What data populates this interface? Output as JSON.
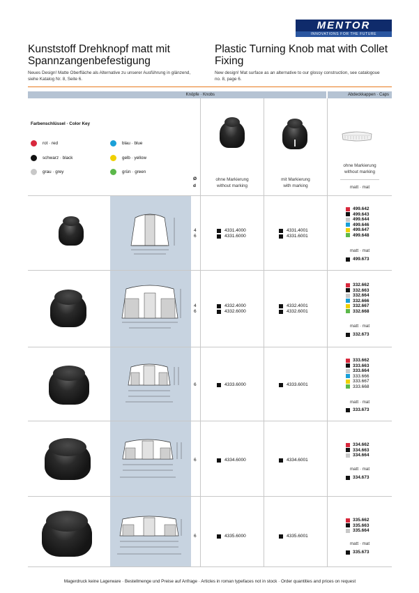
{
  "logo": {
    "word": "MENTOR",
    "tagline": "INNOVATIONS FOR THE FUTURE"
  },
  "title_de": "Kunststoff Drehknopf matt mit Spannzangenbefestigung",
  "title_en": "Plastic Turning Knob mat with Collet Fixing",
  "subtitle_de": "Neues Design! Matte Oberfläche als Alternative zu unserer Ausführung in glänzend, siehe Katalog Nr. 8, Seite 6.",
  "subtitle_en": "New design! Mat surface as an alternative to our glossy construction, see catalogoue no. 8, page 6.",
  "header": {
    "knobs": "Knöpfe · Knobs",
    "caps": "Abdeckkappen · Caps"
  },
  "color_key": {
    "title": "Farbenschlüssel · Color Key",
    "items": [
      {
        "label": "rot · red",
        "color": "#d8283c"
      },
      {
        "label": "blau · blue",
        "color": "#1aa0d8"
      },
      {
        "label": "schwarz · black",
        "color": "#111111"
      },
      {
        "label": "gelb · yellow",
        "color": "#f0d000"
      },
      {
        "label": "grau · grey",
        "color": "#c8c8c8"
      },
      {
        "label": "grün · green",
        "color": "#5cb84a"
      }
    ]
  },
  "columns": {
    "d_top": "Ø",
    "d_bottom": "d",
    "without_marking_de": "ohne Markierung",
    "without_marking_en": "without marking",
    "with_marking_de": "mit Markierung",
    "with_marking_en": "with marking",
    "caps_without_de": "ohne Markierung",
    "caps_without_en": "without marking",
    "caps_finish": "matt · mat"
  },
  "rows": [
    {
      "d": [
        "4",
        "6"
      ],
      "without": [
        "4331.4000",
        "4331.6000"
      ],
      "with": [
        "4331.4001",
        "4331.6001"
      ],
      "caps": [
        {
          "code": "499.642",
          "color": "#d8283c",
          "bold": true
        },
        {
          "code": "499.643",
          "color": "#111111",
          "bold": true
        },
        {
          "code": "499.644",
          "color": "#c8c8c8",
          "bold": true
        },
        {
          "code": "499.646",
          "color": "#1aa0d8",
          "bold": true
        },
        {
          "code": "499.647",
          "color": "#f0d000",
          "bold": true
        },
        {
          "code": "499.648",
          "color": "#5cb84a",
          "bold": true
        }
      ],
      "mat_label": "matt · mat",
      "mat_code": "499.673"
    },
    {
      "d": [
        "4",
        "6"
      ],
      "without": [
        "4332.4000",
        "4332.6000"
      ],
      "with": [
        "4332.4001",
        "4332.6001"
      ],
      "caps": [
        {
          "code": "332.662",
          "color": "#d8283c",
          "bold": true
        },
        {
          "code": "332.663",
          "color": "#111111",
          "bold": true
        },
        {
          "code": "332.664",
          "color": "#c8c8c8",
          "bold": true
        },
        {
          "code": "332.666",
          "color": "#1aa0d8",
          "bold": true
        },
        {
          "code": "332.667",
          "color": "#f0d000",
          "bold": true
        },
        {
          "code": "332.668",
          "color": "#5cb84a",
          "bold": true
        }
      ],
      "mat_label": "matt · mat",
      "mat_code": "332.673"
    },
    {
      "d": [
        "6"
      ],
      "without": [
        "4333.6000"
      ],
      "with": [
        "4333.6001"
      ],
      "caps": [
        {
          "code": "333.662",
          "color": "#d8283c",
          "bold": true
        },
        {
          "code": "333.663",
          "color": "#111111",
          "bold": true
        },
        {
          "code": "333.664",
          "color": "#c8c8c8",
          "bold": true
        },
        {
          "code": "333.666",
          "color": "#1aa0d8",
          "bold": false
        },
        {
          "code": "333.667",
          "color": "#f0d000",
          "bold": false
        },
        {
          "code": "333.668",
          "color": "#5cb84a",
          "bold": false
        }
      ],
      "mat_label": "matt · mat",
      "mat_code": "333.673"
    },
    {
      "d": [
        "6"
      ],
      "without": [
        "4334.6000"
      ],
      "with": [
        "4334.6001"
      ],
      "caps": [
        {
          "code": "334.662",
          "color": "#d8283c",
          "bold": true
        },
        {
          "code": "334.663",
          "color": "#111111",
          "bold": true
        },
        {
          "code": "334.664",
          "color": "#c8c8c8",
          "bold": true
        }
      ],
      "mat_label": "matt · mat",
      "mat_code": "334.673"
    },
    {
      "d": [
        "6"
      ],
      "without": [
        "4335.6000"
      ],
      "with": [
        "4335.6001"
      ],
      "caps": [
        {
          "code": "335.662",
          "color": "#d8283c",
          "bold": true
        },
        {
          "code": "335.663",
          "color": "#111111",
          "bold": true
        },
        {
          "code": "335.664",
          "color": "#c8c8c8",
          "bold": true
        }
      ],
      "mat_label": "matt · mat",
      "mat_code": "335.673"
    }
  ],
  "footer": "Magerdruck keine Lagerware · Bestellmenge und Preise auf Anfrage · Articles in roman typefaces not in stock · Order quantities and prices on request"
}
